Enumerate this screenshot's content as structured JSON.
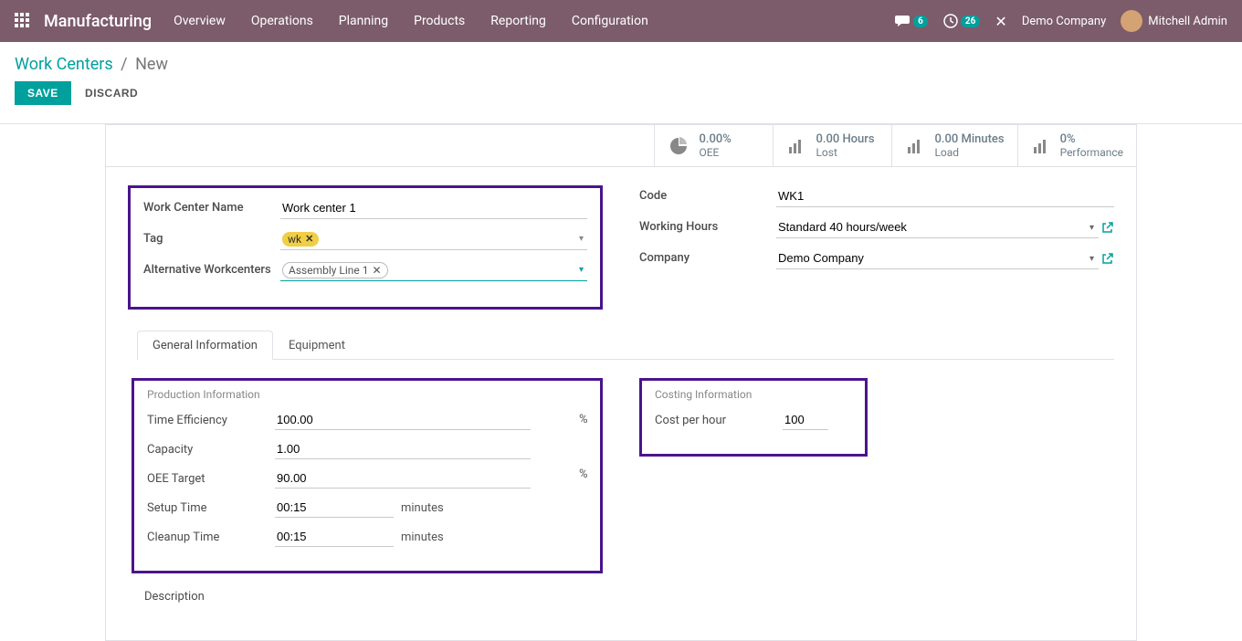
{
  "nav": {
    "brand": "Manufacturing",
    "links": [
      "Overview",
      "Operations",
      "Planning",
      "Products",
      "Reporting",
      "Configuration"
    ],
    "chat_badge": "6",
    "clock_badge": "26",
    "company": "Demo Company",
    "user": "Mitchell Admin"
  },
  "breadcrumb": {
    "root": "Work Centers",
    "current": "New"
  },
  "buttons": {
    "save": "SAVE",
    "discard": "DISCARD"
  },
  "stats": {
    "oee": {
      "value": "0.00%",
      "label": "OEE"
    },
    "lost": {
      "value": "0.00 Hours",
      "label": "Lost"
    },
    "load": {
      "value": "0.00 Minutes",
      "label": "Load"
    },
    "perf": {
      "value": "0%",
      "label": "Performance"
    }
  },
  "form": {
    "work_center_name": {
      "label": "Work Center Name",
      "value": "Work center 1"
    },
    "tag": {
      "label": "Tag",
      "chip": "wk"
    },
    "alt": {
      "label": "Alternative Workcenters",
      "chip": "Assembly Line 1"
    },
    "code": {
      "label": "Code",
      "value": "WK1"
    },
    "working_hours": {
      "label": "Working Hours",
      "value": "Standard 40 hours/week"
    },
    "company": {
      "label": "Company",
      "value": "Demo Company"
    }
  },
  "tabs": {
    "general": "General Information",
    "equipment": "Equipment"
  },
  "prod": {
    "title": "Production Information",
    "time_eff": {
      "label": "Time Efficiency",
      "value": "100.00",
      "unit": "%"
    },
    "capacity": {
      "label": "Capacity",
      "value": "1.00"
    },
    "oee_target": {
      "label": "OEE Target",
      "value": "90.00",
      "unit": "%"
    },
    "setup": {
      "label": "Setup Time",
      "value": "00:15",
      "unit": "minutes"
    },
    "cleanup": {
      "label": "Cleanup Time",
      "value": "00:15",
      "unit": "minutes"
    }
  },
  "cost": {
    "title": "Costing Information",
    "cph": {
      "label": "Cost per hour",
      "value": "100"
    }
  },
  "desc": "Description"
}
